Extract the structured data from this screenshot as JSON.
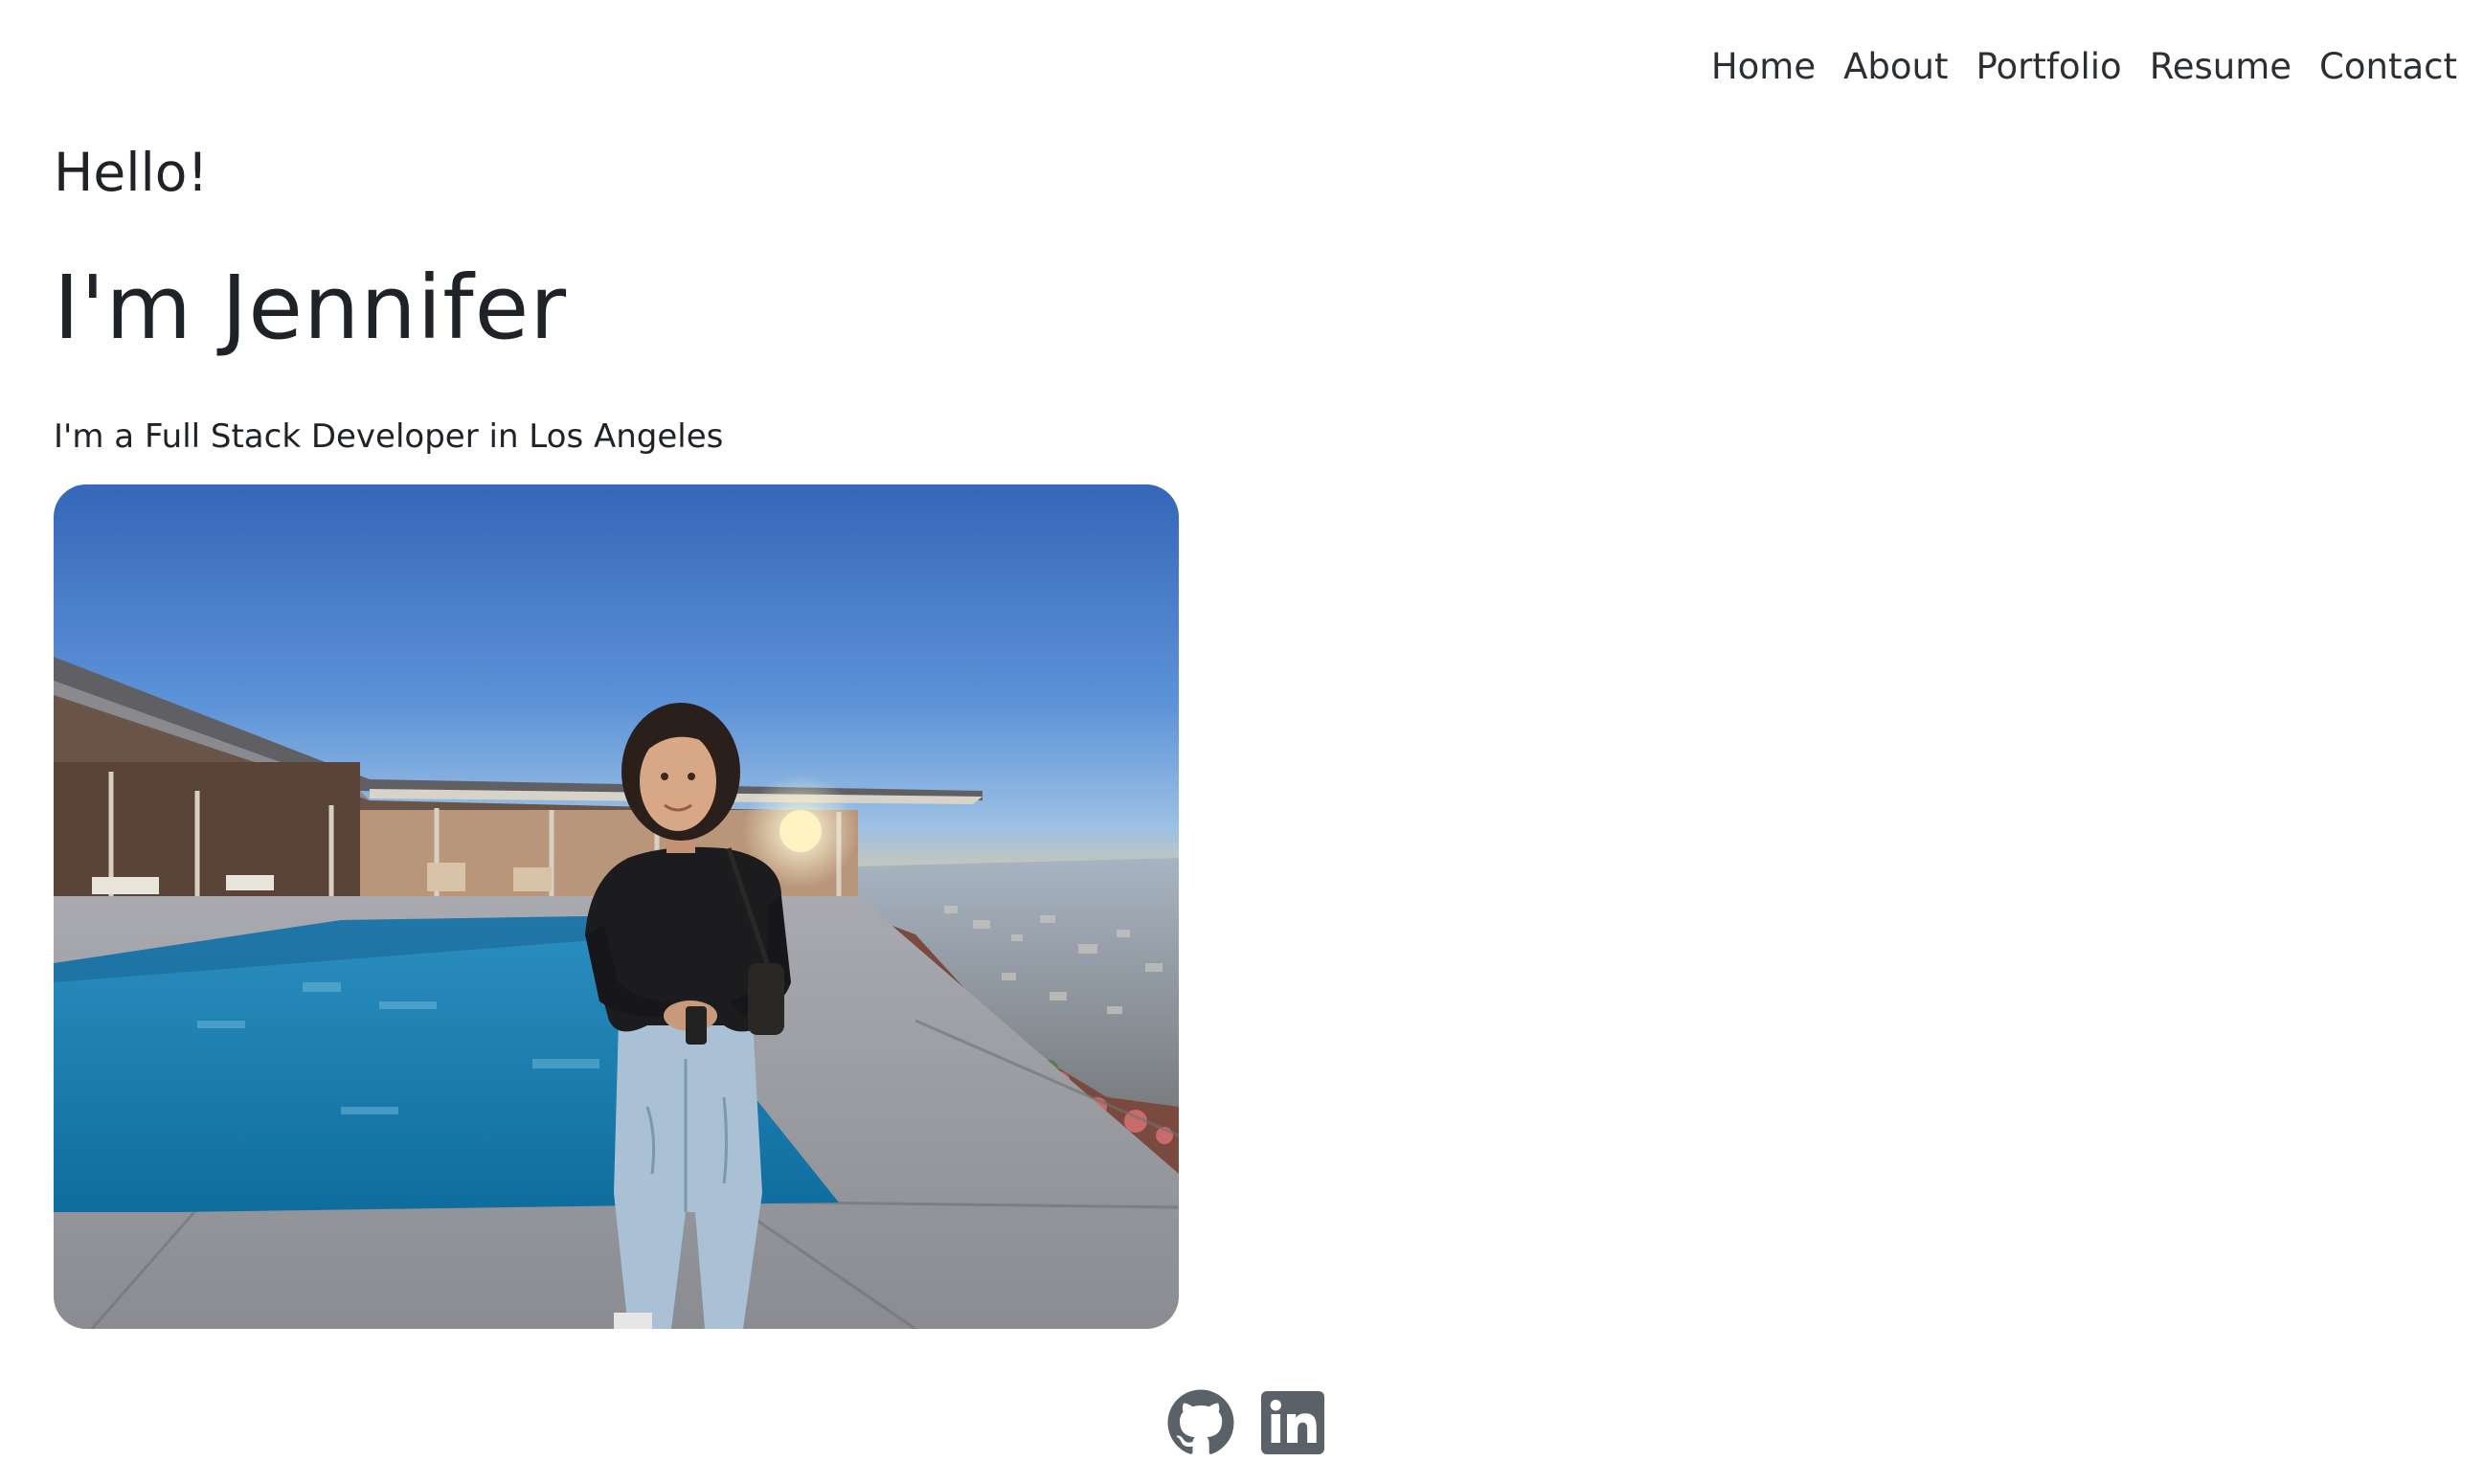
{
  "nav": {
    "items": [
      {
        "label": "Home"
      },
      {
        "label": "About"
      },
      {
        "label": "Portfolio"
      },
      {
        "label": "Resume"
      },
      {
        "label": "Contact"
      }
    ]
  },
  "hero": {
    "greeting": "Hello!",
    "name": "I'm Jennifer",
    "tagline": "I'm a Full Stack Developer in Los Angeles"
  },
  "photo": {
    "subject": "woman-standing-by-pool-with-city-view"
  },
  "social": {
    "icons": [
      "github-icon",
      "linkedin-icon"
    ]
  },
  "colors": {
    "text": "#212529",
    "icon": "#5a6168",
    "sky_top": "#3a6fc0",
    "pool": "#1d86b8"
  }
}
